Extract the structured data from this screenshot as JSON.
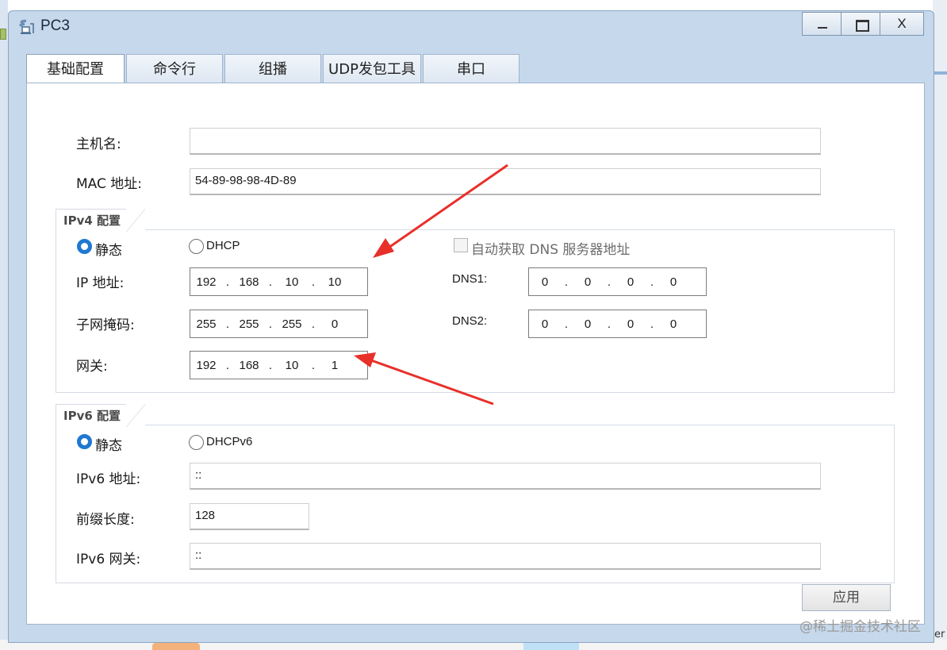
{
  "window": {
    "title": "PC3",
    "controls": {
      "minimize": "—",
      "maximize": "□",
      "close": "X"
    }
  },
  "tabs": [
    {
      "label": "基础配置",
      "active": true
    },
    {
      "label": "命令行",
      "active": false
    },
    {
      "label": "组播",
      "active": false
    },
    {
      "label": "UDP发包工具",
      "active": false
    },
    {
      "label": "串口",
      "active": false
    }
  ],
  "basic": {
    "hostname_label": "主机名:",
    "hostname_value": "",
    "mac_label": "MAC 地址:",
    "mac_value": "54-89-98-98-4D-89"
  },
  "ipv4": {
    "group_title": "IPv4 配置",
    "static_label": "静态",
    "dhcp_label": "DHCP",
    "mode": "static",
    "auto_dns_label": "自动获取 DNS 服务器地址",
    "auto_dns_checked": false,
    "ip_label": "IP 地址:",
    "ip": [
      "192",
      "168",
      "10",
      "10"
    ],
    "mask_label": "子网掩码:",
    "mask": [
      "255",
      "255",
      "255",
      "0"
    ],
    "gateway_label": "网关:",
    "gateway": [
      "192",
      "168",
      "10",
      "1"
    ],
    "dns1_label": "DNS1:",
    "dns1": [
      "0",
      "0",
      "0",
      "0"
    ],
    "dns2_label": "DNS2:",
    "dns2": [
      "0",
      "0",
      "0",
      "0"
    ]
  },
  "ipv6": {
    "group_title": "IPv6 配置",
    "static_label": "静态",
    "dhcp_label": "DHCPv6",
    "mode": "static",
    "addr_label": "IPv6 地址:",
    "addr_value": "::",
    "prefix_label": "前缀长度:",
    "prefix_value": "128",
    "gateway_label": "IPv6 网关:",
    "gateway_value": "::"
  },
  "apply_label": "应用",
  "watermark": "@稀土掘金技术社区",
  "background_fragment_text": "er",
  "colors": {
    "annotation_arrow": "#e8302a",
    "radio_selected": "#1f78d1"
  },
  "annotations": [
    "arrow pointing to IP address",
    "arrow pointing to gateway"
  ]
}
